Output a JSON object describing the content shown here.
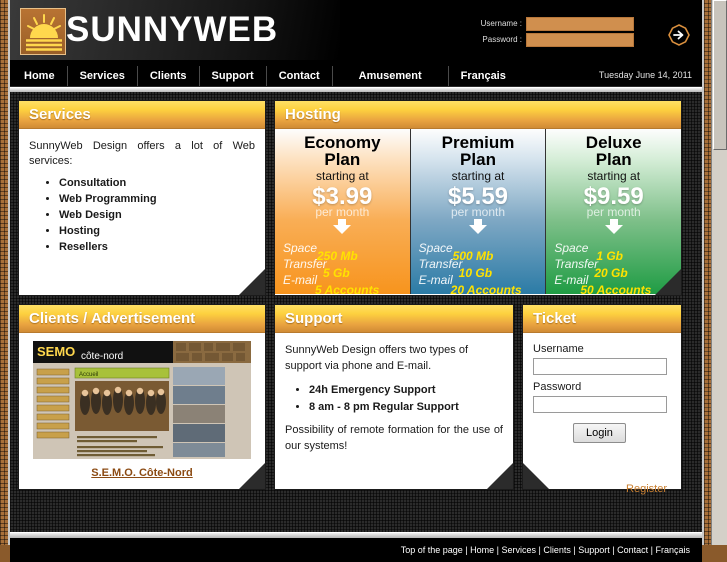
{
  "brand": {
    "name": "SUNNYWEB",
    "logo_icon": "sun-logo-icon"
  },
  "header": {
    "username_label": "Username :",
    "password_label": "Password :",
    "username_value": "",
    "password_value": "",
    "go_icon": "arrow-right-circle-icon"
  },
  "nav": {
    "items": [
      {
        "label": "Home"
      },
      {
        "label": "Services"
      },
      {
        "label": "Clients"
      },
      {
        "label": "Support"
      },
      {
        "label": "Contact"
      },
      {
        "label": "Amusement"
      },
      {
        "label": "Français"
      }
    ],
    "date": "Tuesday June 14, 2011"
  },
  "services": {
    "title": "Services",
    "intro": "SunnyWeb Design offers a lot of Web services:",
    "items": [
      "Consultation",
      "Web Programming",
      "Web Design",
      "Hosting",
      "Resellers"
    ]
  },
  "hosting": {
    "title": "Hosting",
    "starting_label": "starting at",
    "per_month_label": "per month",
    "arrow_icon": "down-arrow-icon",
    "plans": [
      {
        "name_line1": "Economy",
        "name_line2": "Plan",
        "price": "$3.99",
        "space_label": "Space",
        "space_value": "250 Mb",
        "transfer_label": "Transfer",
        "transfer_value": "5 Gb",
        "email_label": "E-mail",
        "email_value": "5 Accounts",
        "accent": "#f7941d"
      },
      {
        "name_line1": "Premium",
        "name_line2": "Plan",
        "price": "$5.59",
        "space_label": "Space",
        "space_value": "500 Mb",
        "transfer_label": "Transfer",
        "transfer_value": "10 Gb",
        "email_label": "E-mail",
        "email_value": "20 Accounts",
        "accent": "#2b7ba6"
      },
      {
        "name_line1": "Deluxe",
        "name_line2": "Plan",
        "price": "$9.59",
        "space_label": "Space",
        "space_value": "1 Gb",
        "transfer_label": "Transfer",
        "transfer_value": "20 Gb",
        "email_label": "E-mail",
        "email_value": "50 Accounts",
        "accent": "#1f9c44"
      }
    ]
  },
  "clients": {
    "title": "Clients / Advertisement",
    "screenshot_alt": "semo-cote-nord-website-thumbnail",
    "link_label": "S.E.M.O. Côte-Nord",
    "thumb": {
      "logo_text": "SEMO",
      "logo_sub": "côte-nord",
      "page_tab": "Accueil"
    }
  },
  "support": {
    "title": "Support",
    "intro": "SunnyWeb Design offers two types of support via phone and E-mail.",
    "items": [
      "24h Emergency Support",
      "8 am - 8 pm Regular Support"
    ],
    "outro": "Possibility of remote formation for the use of our systems!"
  },
  "ticket": {
    "title": "Ticket",
    "username_label": "Username",
    "password_label": "Password",
    "username_value": "",
    "password_value": "",
    "login_label": "Login",
    "register_label": "Register"
  },
  "footer": {
    "items": [
      "Top of the page",
      "Home",
      "Services",
      "Clients",
      "Support",
      "Contact",
      "Français"
    ]
  }
}
